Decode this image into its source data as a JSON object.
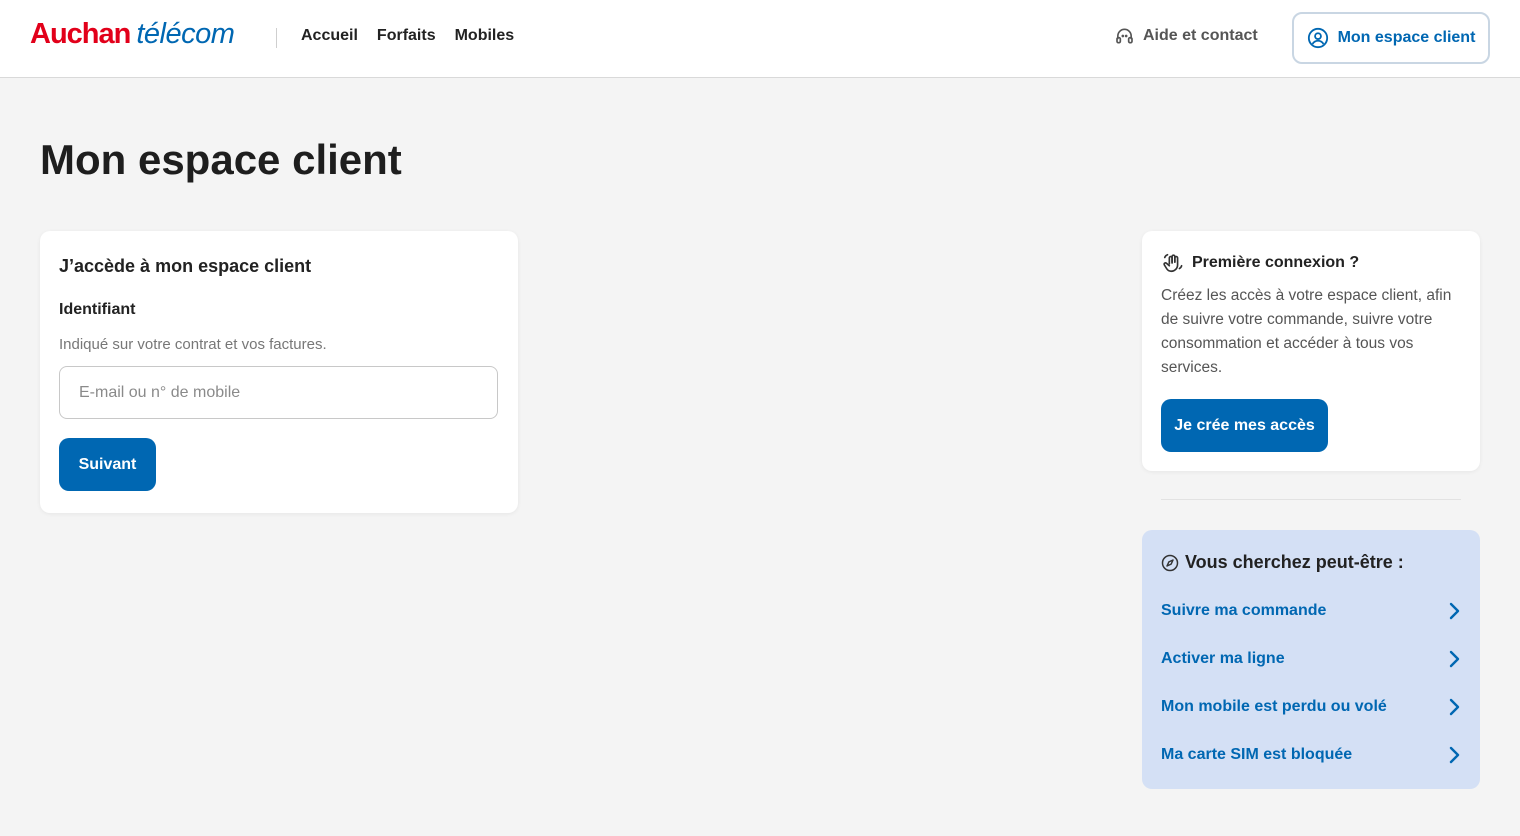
{
  "header": {
    "logo_part1": "Auchan",
    "logo_part2": "télécom",
    "nav": [
      "Accueil",
      "Forfaits",
      "Mobiles"
    ],
    "help_label": "Aide et contact",
    "account_label": "Mon espace client"
  },
  "page": {
    "title": "Mon espace client"
  },
  "login": {
    "title": "J’accède à mon espace client",
    "field_label": "Identifiant",
    "field_help": "Indiqué sur votre contrat et vos factures.",
    "field_placeholder": "E-mail ou n° de mobile",
    "field_value": "",
    "submit_label": "Suivant"
  },
  "first_connection": {
    "title": "Première connexion ?",
    "text": "Créez les accès à votre espace client, afin de suivre votre commande, suivre votre consommation et accéder à tous vos services.",
    "button_label": "Je crée mes accès"
  },
  "suggestions": {
    "title": "Vous cherchez peut-être :",
    "items": [
      "Suivre ma commande",
      "Activer ma ligne",
      "Mon mobile est perdu ou volé",
      "Ma carte SIM est bloquée"
    ]
  },
  "colors": {
    "brand_red": "#e2001a",
    "brand_blue": "#0067b2",
    "suggest_bg": "#d4e0f5",
    "page_bg": "#f4f4f4"
  },
  "icons": {
    "help": "headset-icon",
    "account": "user-circle-icon",
    "first_connection": "waving-hand-icon",
    "suggestions": "compass-icon",
    "suggestion_item": "chevron-right-icon"
  }
}
